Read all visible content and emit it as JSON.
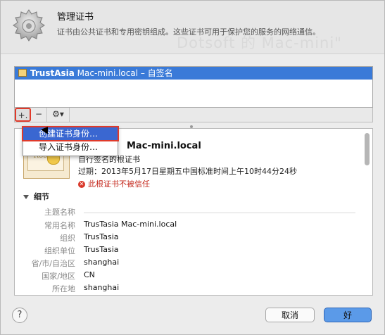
{
  "header": {
    "title": "管理证书",
    "description": "证书由公共证书和专用密钥组成。这些证书可用于保护您的服务的网络通信。",
    "watermark": "Dotsoft 的 Mac-mini\""
  },
  "list": {
    "rows": [
      {
        "bold": "TrustAsia",
        "rest": " Mac-mini.local – 自签名"
      }
    ]
  },
  "toolbar": {
    "add_label": "+.",
    "remove_label": "−",
    "gear_label": "⚙▾"
  },
  "menu": {
    "items": [
      "创建证书身份…",
      "导入证书身份…"
    ]
  },
  "detail": {
    "cert_image_text": "Root",
    "name": "Mac-mini.local",
    "type": "自行签名的根证书",
    "expiry": "过期：2013年5月17日星期五中国标准时间上午10时44分24秒",
    "trust_warning": "此根证书不被信任",
    "section_label": "细节",
    "fields": [
      {
        "label": "主题名称",
        "value": ""
      },
      {
        "label": "常用名称",
        "value": "TrusTasia Mac-mini.local"
      },
      {
        "label": "组织",
        "value": "TrusTasia"
      },
      {
        "label": "组织单位",
        "value": "TrusTasia"
      },
      {
        "label": "省/市/自治区",
        "value": "shanghai"
      },
      {
        "label": "国家/地区",
        "value": "CN"
      },
      {
        "label": "所在地",
        "value": "shanghai"
      }
    ]
  },
  "footer": {
    "help_label": "?",
    "cancel_label": "取消",
    "ok_label": "好"
  },
  "colors": {
    "selection": "#3a7ad8",
    "highlight_outline": "#e03a2a",
    "default_button": "#5b9ae8"
  }
}
